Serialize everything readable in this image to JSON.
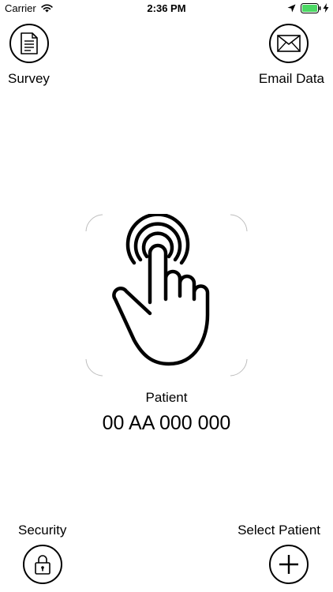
{
  "status_bar": {
    "carrier": "Carrier",
    "time": "2:36 PM",
    "icons": [
      "wifi-icon",
      "location-icon",
      "battery-icon",
      "charging-icon"
    ],
    "battery_color": "#4cd964"
  },
  "top_actions": {
    "survey": {
      "label": "Survey",
      "icon": "document-icon"
    },
    "email": {
      "label": "Email Data",
      "icon": "envelope-icon"
    }
  },
  "main": {
    "touch_icon": "touch-hand-icon",
    "patient_label": "Patient",
    "patient_id": "00 AA 000 000"
  },
  "bottom_actions": {
    "security": {
      "label": "Security",
      "icon": "padlock-icon"
    },
    "select_patient": {
      "label": "Select Patient",
      "icon": "plus-icon"
    }
  }
}
